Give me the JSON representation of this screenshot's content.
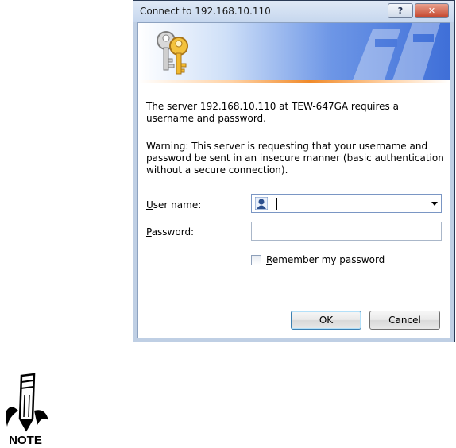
{
  "dialog": {
    "title": "Connect to 192.168.10.110",
    "help_label": "?",
    "close_label": "✕",
    "message": "The server 192.168.10.110 at TEW-647GA requires a username and password.",
    "warning": "Warning: This server is requesting that your username and password be sent in an insecure manner (basic authentication without a secure connection).",
    "username_label_underline": "U",
    "username_label_rest": "ser name:",
    "username_value": "",
    "password_label_underline": "P",
    "password_label_rest": "assword:",
    "password_value": "",
    "remember_underline": "R",
    "remember_rest": "emember my password",
    "remember_checked": false,
    "ok_label": "OK",
    "cancel_label": "Cancel"
  },
  "note": {
    "label": "NOTE"
  },
  "icons": {
    "banner": "keys-icon",
    "user": "user-account-icon",
    "note": "pencil-note-icon"
  }
}
